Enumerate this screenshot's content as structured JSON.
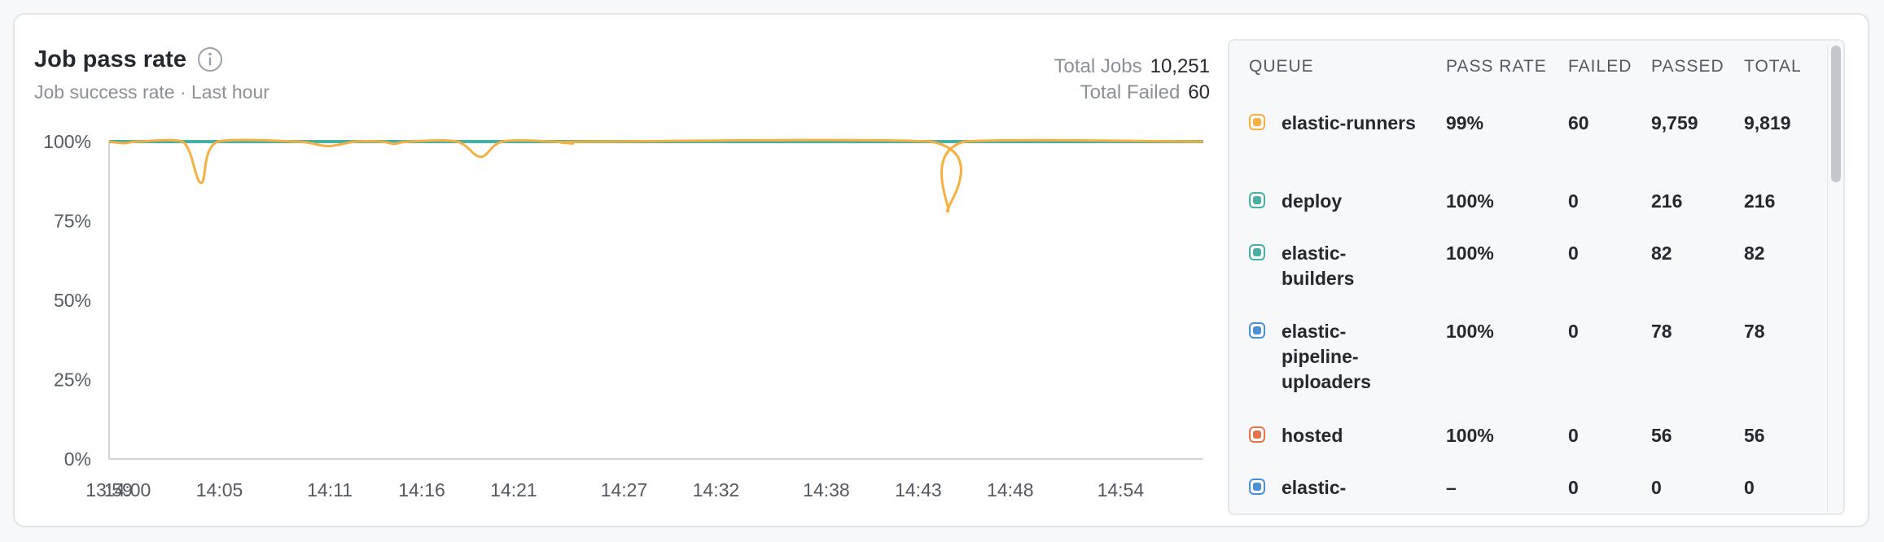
{
  "header": {
    "title": "Job pass rate",
    "subtitle": "Job success rate · Last hour",
    "info_icon": "info-icon"
  },
  "totals": {
    "total_jobs_label": "Total Jobs",
    "total_jobs_value": "10,251",
    "total_failed_label": "Total Failed",
    "total_failed_value": "60"
  },
  "colors": {
    "orange": "#f5b041",
    "teal": "#45b0a5",
    "blue": "#4a90d9",
    "red": "#e8734a",
    "axis": "#d0d4da",
    "text_muted": "#8b9097"
  },
  "chart_data": {
    "type": "line",
    "title": "Job pass rate",
    "subtitle": "Job success rate · Last hour",
    "y_ticks": [
      "100%",
      "75%",
      "50%",
      "25%",
      "0%"
    ],
    "x_ticks": [
      "13:59",
      "14:00",
      "14:05",
      "14:11",
      "14:16",
      "14:21",
      "14:27",
      "14:32",
      "14:38",
      "14:43",
      "14:48",
      "14:54"
    ],
    "ylim": [
      0,
      100
    ],
    "x_range_minutes": [
      0,
      59.5
    ],
    "grid": false,
    "series": [
      {
        "name": "elastic-runners",
        "color": "#f5b041",
        "points": [
          {
            "t": 0.0,
            "v": 100
          },
          {
            "t": 0.8,
            "v": 99.5
          },
          {
            "t": 1.6,
            "v": 100
          },
          {
            "t": 4.0,
            "v": 100
          },
          {
            "t": 5.0,
            "v": 87
          },
          {
            "t": 5.9,
            "v": 100
          },
          {
            "t": 10.2,
            "v": 100
          },
          {
            "t": 11.9,
            "v": 98.6
          },
          {
            "t": 13.4,
            "v": 100
          },
          {
            "t": 14.8,
            "v": 100
          },
          {
            "t": 15.5,
            "v": 99.3
          },
          {
            "t": 16.3,
            "v": 100
          },
          {
            "t": 18.9,
            "v": 100
          },
          {
            "t": 20.2,
            "v": 95.2
          },
          {
            "t": 21.4,
            "v": 100
          },
          {
            "t": 24.2,
            "v": 100
          },
          {
            "t": 25.2,
            "v": 99.4
          },
          {
            "t": 26.2,
            "v": 100
          },
          {
            "t": 44.7,
            "v": 100
          },
          {
            "t": 45.6,
            "v": 78
          },
          {
            "t": 46.5,
            "v": 100
          },
          {
            "t": 59.5,
            "v": 100
          }
        ]
      },
      {
        "name": "deploy",
        "color": "#45b0a5",
        "points": [
          {
            "t": 0.0,
            "v": 100
          },
          {
            "t": 59.5,
            "v": 100
          }
        ]
      }
    ]
  },
  "table": {
    "columns": [
      "QUEUE",
      "PASS RATE",
      "FAILED",
      "PASSED",
      "TOTAL"
    ],
    "rows": [
      {
        "queue": "elastic-runners",
        "pass_rate": "99%",
        "failed": "60",
        "passed": "9,759",
        "total": "9,819",
        "color": "#f5b041"
      },
      {
        "queue": "deploy",
        "pass_rate": "100%",
        "failed": "0",
        "passed": "216",
        "total": "216",
        "color": "#45b0a5"
      },
      {
        "queue": "elastic-builders",
        "pass_rate": "100%",
        "failed": "0",
        "passed": "82",
        "total": "82",
        "color": "#45b0a5"
      },
      {
        "queue": "elastic-pipeline-uploaders",
        "pass_rate": "100%",
        "failed": "0",
        "passed": "78",
        "total": "78",
        "color": "#4a90d9"
      },
      {
        "queue": "hosted",
        "pass_rate": "100%",
        "failed": "0",
        "passed": "56",
        "total": "56",
        "color": "#e8734a"
      },
      {
        "queue": "elastic-",
        "pass_rate": "–",
        "failed": "0",
        "passed": "0",
        "total": "0",
        "color": "#4a90d9"
      }
    ]
  }
}
